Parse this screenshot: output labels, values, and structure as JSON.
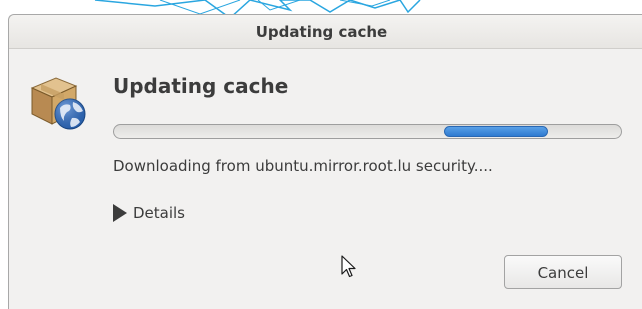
{
  "window": {
    "title": "Updating cache"
  },
  "dialog": {
    "heading": "Updating cache",
    "status_text": "Downloading from ubuntu.mirror.root.lu security....",
    "details_label": "Details",
    "cancel_label": "Cancel",
    "icon": "package-globe-icon"
  },
  "progress": {
    "state": "indeterminate",
    "color": "#3b86d9"
  },
  "colors": {
    "window_background": "#f2f1f0",
    "text": "#3c3c3c",
    "accent": "#3b86d9",
    "decoration": "#2aa6e0"
  }
}
